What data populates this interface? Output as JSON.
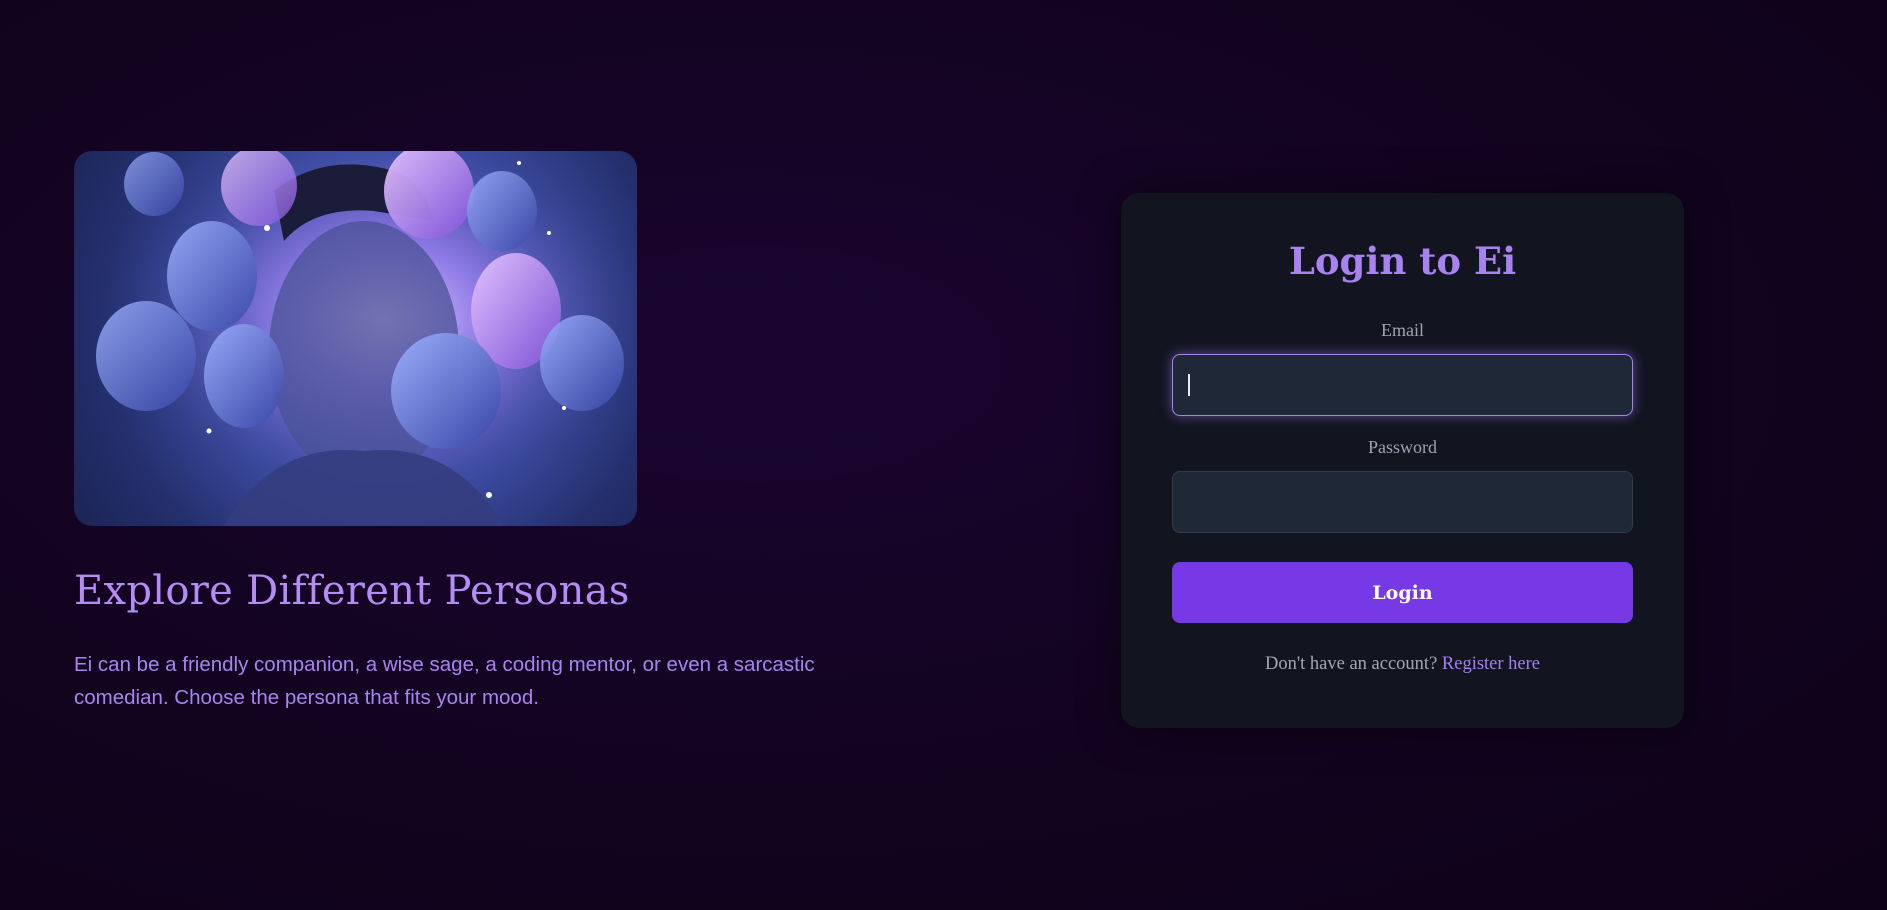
{
  "hero": {
    "title": "Explore Different Personas",
    "description": "Ei can be a friendly companion, a wise sage, a coding mentor, or even a sarcastic comedian. Choose the persona that fits your mood.",
    "image_icon": "persona-masks-illustration"
  },
  "login": {
    "title": "Login to Ei",
    "email_label": "Email",
    "email_value": "",
    "password_label": "Password",
    "password_value": "",
    "button_label": "Login",
    "register_prompt": "Don't have an account?",
    "register_link": "Register here"
  },
  "colors": {
    "background": "#12031e",
    "accent": "#7738e6",
    "heading": "#a783ef",
    "card": "#121420",
    "input": "#1f2836"
  }
}
